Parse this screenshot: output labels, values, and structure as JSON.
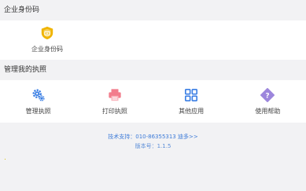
{
  "enterprise_section": {
    "title": "企业身份码",
    "items": [
      {
        "label": "企业身份码",
        "icon": "shield-badge-icon",
        "color": "#f0b400"
      }
    ]
  },
  "license_section": {
    "title": "管理我的执照",
    "items": [
      {
        "label": "管理执照",
        "icon": "gear-icon",
        "color": "#3a7ee4"
      },
      {
        "label": "打印执照",
        "icon": "printer-icon",
        "color": "#f27d8c"
      },
      {
        "label": "其他应用",
        "icon": "grid-apps-icon",
        "color": "#3a7ee4"
      },
      {
        "label": "使用帮助",
        "icon": "help-icon",
        "color": "#9c86dc"
      }
    ]
  },
  "footer": {
    "support": "技术支持：010-86355313 迪多>>",
    "version": "版本号：1.1.5"
  }
}
